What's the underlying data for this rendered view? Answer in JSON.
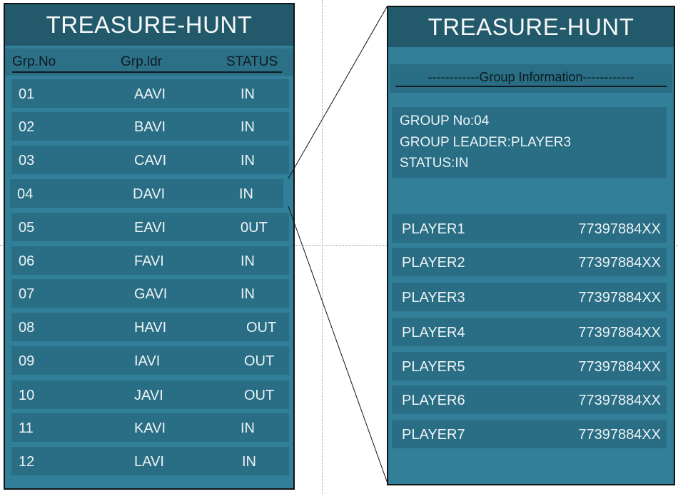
{
  "left_panel": {
    "title": "TREASURE-HUNT",
    "columns": {
      "grp_no": "Grp.No",
      "grp_ldr": "Grp.ldr",
      "status": "STATUS"
    },
    "groups": [
      {
        "no": "01",
        "leader": "AAVI",
        "status": "IN"
      },
      {
        "no": "02",
        "leader": "BAVI",
        "status": "IN"
      },
      {
        "no": "03",
        "leader": "CAVI",
        "status": "IN"
      },
      {
        "no": "04",
        "leader": "DAVI",
        "status": "IN"
      },
      {
        "no": "05",
        "leader": "EAVI",
        "status": "0UT"
      },
      {
        "no": "06",
        "leader": "FAVI",
        "status": "IN"
      },
      {
        "no": "07",
        "leader": "GAVI",
        "status": "IN"
      },
      {
        "no": "08",
        "leader": "HAVI",
        "status": "OUT"
      },
      {
        "no": "09",
        "leader": "IAVI",
        "status": "OUT"
      },
      {
        "no": "10",
        "leader": "JAVI",
        "status": "OUT"
      },
      {
        "no": "11",
        "leader": "KAVI",
        "status": "IN"
      },
      {
        "no": "12",
        "leader": "LAVI",
        "status": "IN"
      }
    ]
  },
  "right_panel": {
    "title": "TREASURE-HUNT",
    "section_header": "------------Group Information------------",
    "group_no": "GROUP No:04",
    "group_leader": "GROUP LEADER:PLAYER3",
    "status": "STATUS:IN",
    "players": [
      {
        "name": "PLAYER1",
        "phone": "77397884XX"
      },
      {
        "name": "PLAYER2",
        "phone": "77397884XX"
      },
      {
        "name": "PLAYER3",
        "phone": "77397884XX"
      },
      {
        "name": "PLAYER4",
        "phone": "77397884XX"
      },
      {
        "name": "PLAYER5",
        "phone": "77397884XX"
      },
      {
        "name": "PLAYER6",
        "phone": "77397884XX"
      },
      {
        "name": "PLAYER7",
        "phone": "77397884XX"
      }
    ]
  },
  "colors": {
    "panel": "#327f99",
    "title_bar": "#225a6b",
    "row": "#296e85",
    "border": "#0f1416"
  }
}
